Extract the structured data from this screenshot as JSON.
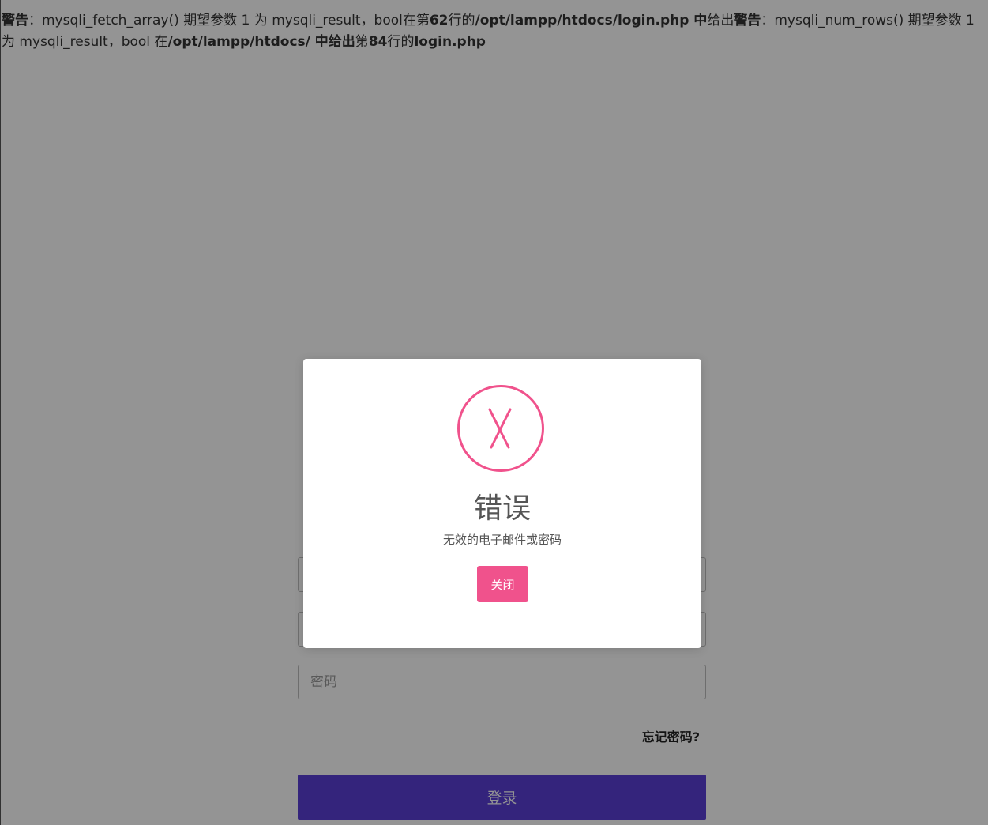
{
  "warning": {
    "part1_label": "警告",
    "part1_sep": "：",
    "part1_text": "mysqli_fetch_array() 期望参数 1 为 mysqli_result，bool在第",
    "part1_line": "62",
    "part1_line_suffix": "行的",
    "part1_path": "/opt/lampp/htdocs/login.php 中",
    "part2_mid": "给出",
    "part2_label": "警告",
    "part2_sep": "：",
    "part2_text": "mysqli_num_rows() 期望参数 1 为 mysqli_result，bool 在",
    "part2_path": "/opt/lampp/htdocs/ 中给出",
    "part2_prefix": "第",
    "part2_line": "84",
    "part2_line_suffix": "行的",
    "part2_file": "login.php"
  },
  "login": {
    "field1_placeholder": "",
    "field2_placeholder": "",
    "password_placeholder": "密码",
    "forgot_label": "忘记密码?",
    "submit_label": "登录"
  },
  "modal": {
    "icon": "close-x-icon",
    "title": "错误",
    "message": "无效的电子邮件或密码",
    "close_label": "关闭"
  },
  "colors": {
    "accent": "#f0528c",
    "primary": "#5a3fd6",
    "overlay": "rgba(0,0,0,0.42)"
  }
}
